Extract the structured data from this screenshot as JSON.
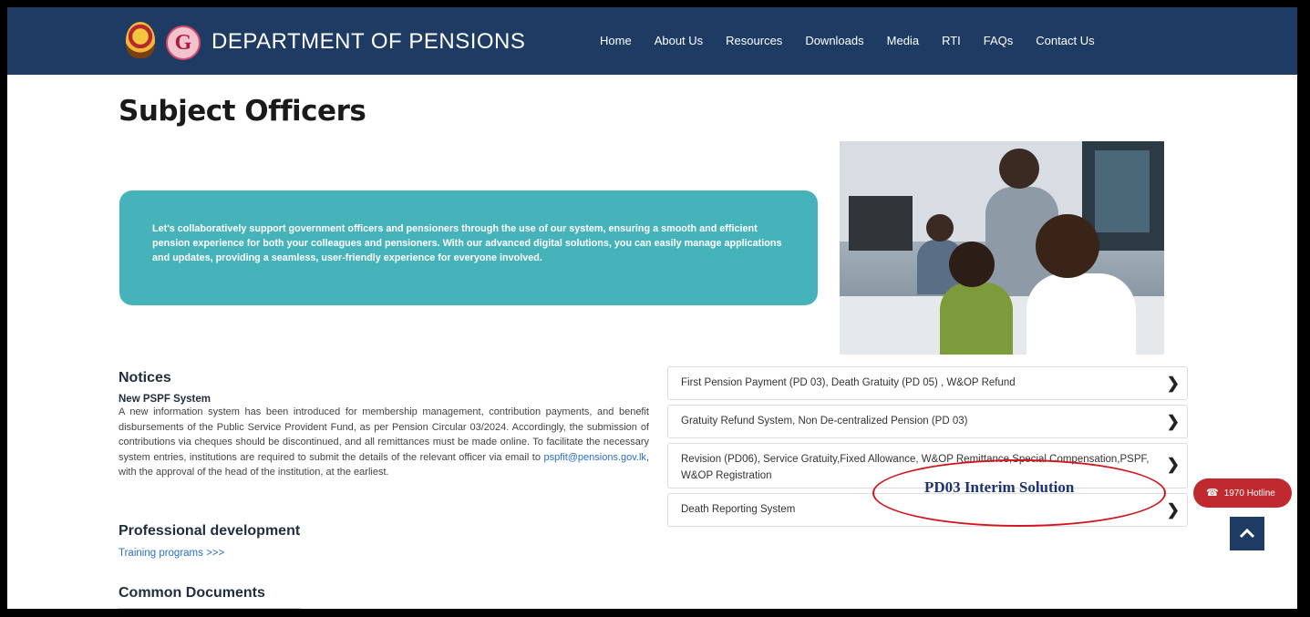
{
  "header": {
    "brand": "DEPARTMENT OF PENSIONS",
    "logo_letter": "G",
    "nav": [
      "Home",
      "About Us",
      "Resources",
      "Downloads",
      "Media",
      "RTI",
      "FAQs",
      "Contact Us"
    ]
  },
  "page": {
    "title": "Subject Officers",
    "banner_text": "Let's collaboratively support government officers and pensioners through the use of our system, ensuring a smooth and efficient pension experience for both your colleagues and pensioners. With our advanced digital solutions, you can easily manage applications and updates, providing a seamless, user-friendly experience for everyone involved."
  },
  "notices": {
    "heading": "Notices",
    "title": "New PSPF System",
    "body_before_link": "A new information system has been introduced for membership management, contribution payments, and benefit disbursements of the Public Service Provident Fund, as per Pension Circular 03/2024. Accordingly, the submission of contributions via cheques should be discontinued, and all remittances must be made online. To facilitate the necessary system entries, institutions are required to submit the details of the relevant officer via email to ",
    "email": "pspfit@pensions.gov.lk",
    "body_after_link": ", with the approval of the head of the institution, at the earliest."
  },
  "professional": {
    "heading": "Professional development",
    "link": "Training programs >>>"
  },
  "common_documents": {
    "heading": "Common Documents"
  },
  "systems": [
    "First Pension Payment (PD 03), Death Gratuity (PD 05) , W&OP Refund",
    "Gratuity Refund System, Non De-centralized Pension (PD 03)",
    "Revision (PD06), Service Gratuity,Fixed Allowance, W&OP Remittance,Special Compensation,PSPF, W&OP Registration",
    "Death Reporting System"
  ],
  "annotation": {
    "label": "PD03 Interim Solution",
    "color": "#d4141b"
  },
  "hotline": {
    "label": "1970 Hotline",
    "icon": "phone-icon"
  },
  "colors": {
    "navbar": "#1d3b63",
    "banner": "#46b3bb",
    "hotline": "#c02a2e",
    "link": "#2a6fc9"
  }
}
